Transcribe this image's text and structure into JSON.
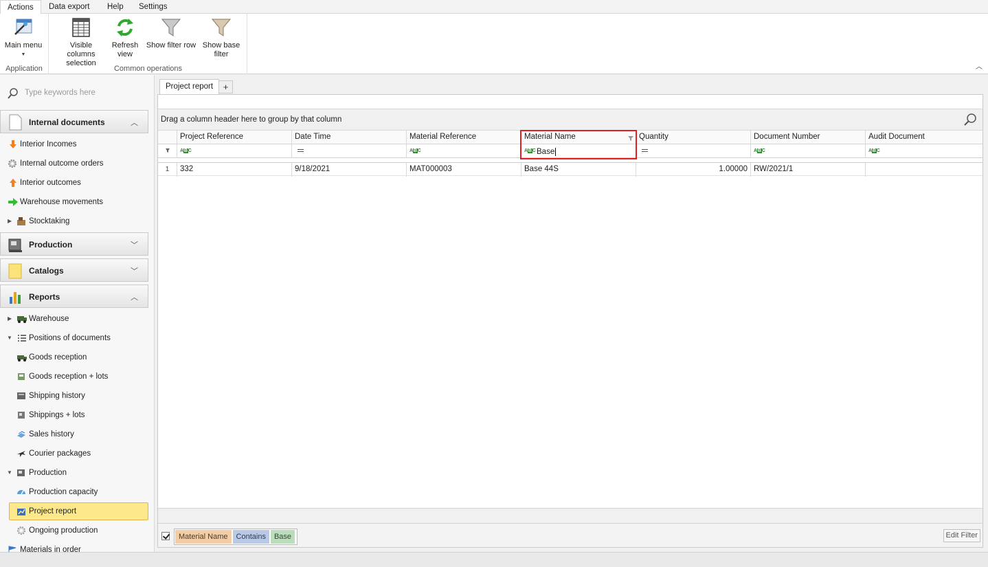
{
  "ribbon": {
    "tabs": [
      "Actions",
      "Data export",
      "Help",
      "Settings"
    ],
    "groups": {
      "application": {
        "label": "Application",
        "main_menu": "Main menu"
      },
      "common": {
        "label": "Common operations",
        "visible_columns": [
          "Visible columns",
          "selection"
        ],
        "refresh": [
          "Refresh",
          "view"
        ],
        "show_filter_row": "Show filter row",
        "show_base_filter": [
          "Show base",
          "filter"
        ]
      }
    }
  },
  "nav": {
    "search_placeholder": "Type keywords here",
    "groups": {
      "internal_documents": "Internal documents",
      "production": "Production",
      "catalogs": "Catalogs",
      "reports": "Reports"
    },
    "internal_items": [
      "Interior Incomes",
      "Internal outcome orders",
      "Interior outcomes",
      "Warehouse movements",
      "Stocktaking"
    ],
    "report_items": {
      "warehouse": "Warehouse",
      "positions": "Positions of documents",
      "goods_reception": "Goods reception",
      "goods_reception_lots": "Goods reception + lots",
      "shipping_history": "Shipping history",
      "shippings_lots": "Shippings + lots",
      "sales_history": "Sales history",
      "courier_packages": "Courier packages",
      "production": "Production",
      "production_capacity": "Production capacity",
      "project_report": "Project report",
      "ongoing_production": "Ongoing production",
      "materials_in_order": "Materials in order"
    }
  },
  "document_tab": {
    "title": "Project report",
    "add": "+"
  },
  "grid": {
    "group_panel_text": "Drag a column header here to group by that column",
    "columns": [
      "Project Reference",
      "Date Time",
      "Material Reference",
      "Material Name",
      "Quantity",
      "Document Number",
      "Audit Document"
    ],
    "filter_row": {
      "material_name_value": "Base"
    },
    "rows": [
      {
        "num": "1",
        "project_reference": "332",
        "date_time": "9/18/2021",
        "material_reference": "MAT000003",
        "material_name": "Base 44S",
        "quantity": "1.00000",
        "document_number": "RW/2021/1",
        "audit_document": ""
      }
    ]
  },
  "filter_panel": {
    "field": "Material Name",
    "operator": "Contains",
    "value": "Base",
    "edit_button": "Edit Filter"
  }
}
